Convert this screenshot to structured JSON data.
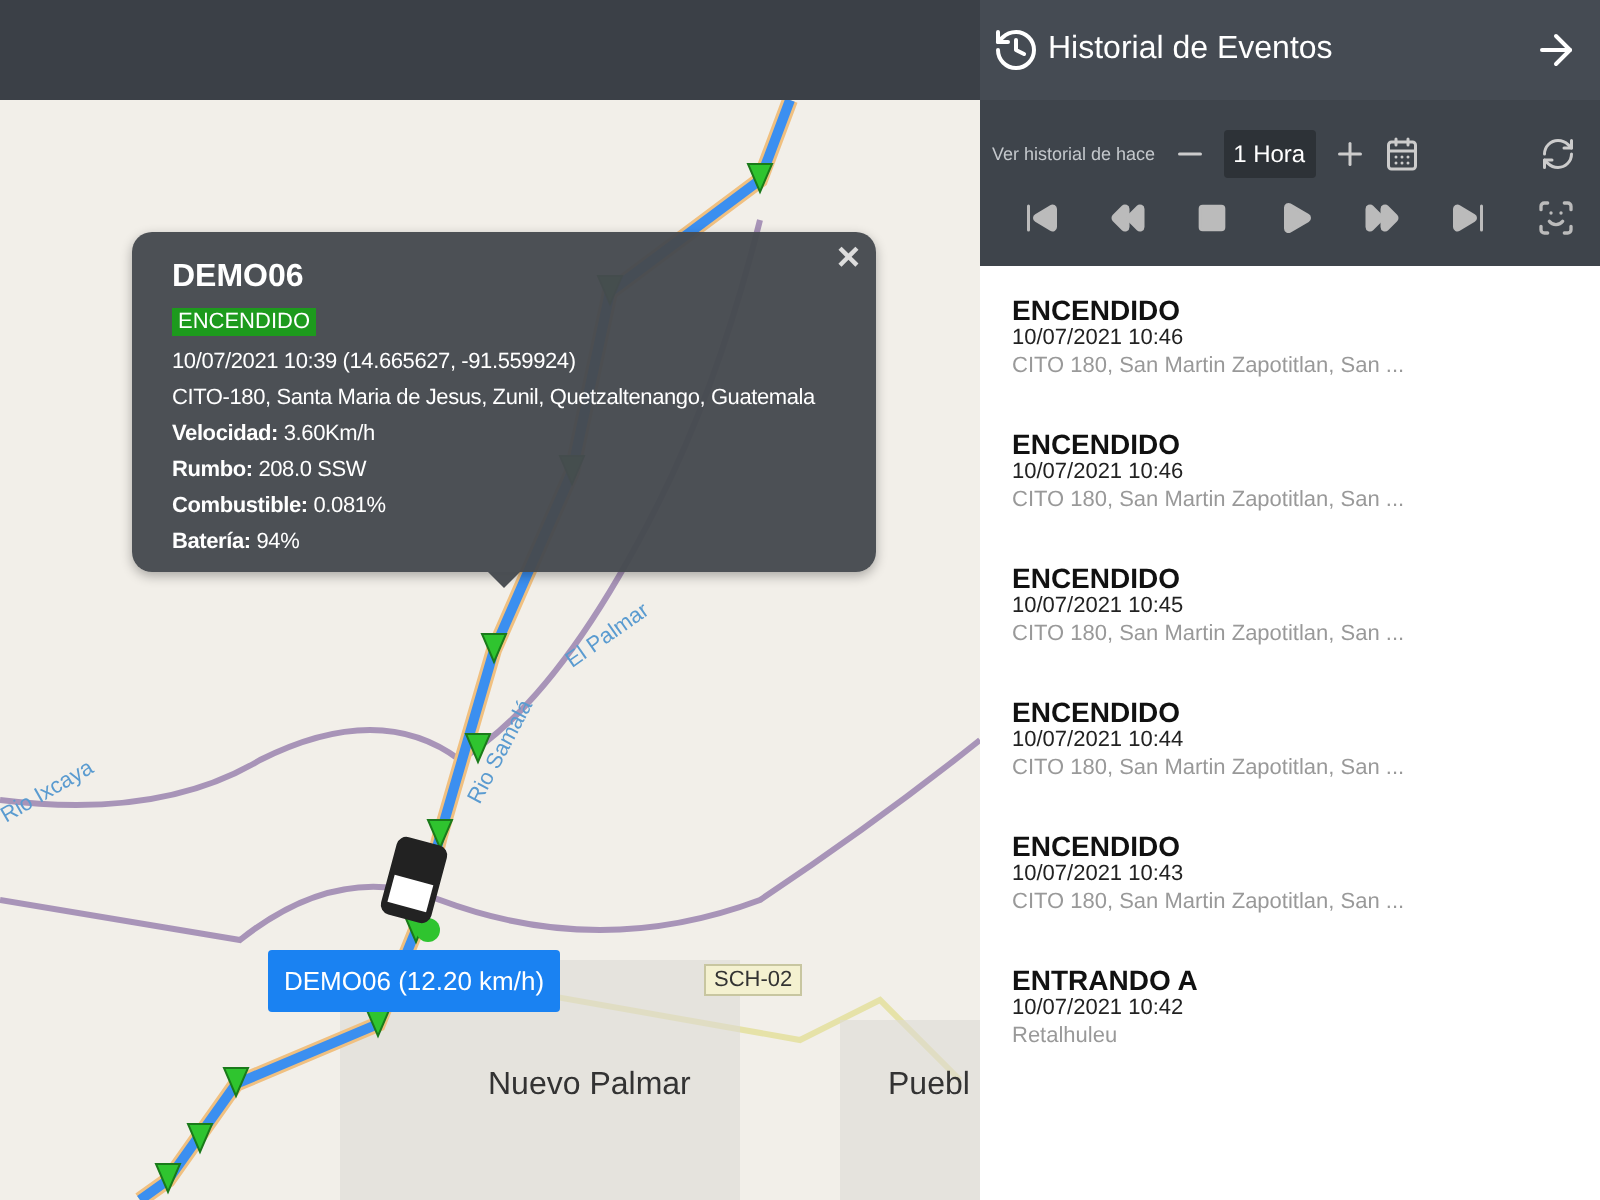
{
  "map": {
    "labels": [
      {
        "text": "El Palmar",
        "kind": "river"
      },
      {
        "text": "Rio Samalá",
        "kind": "river"
      },
      {
        "text": "Rio Ixcaya",
        "kind": "river"
      },
      {
        "text": "SCH-02",
        "kind": "road"
      },
      {
        "text": "Nuevo Palmar",
        "kind": "place"
      },
      {
        "text": "Puebl",
        "kind": "place"
      }
    ],
    "popup": {
      "title": "DEMO06",
      "status": "ENCENDIDO",
      "close": "×",
      "lines": [
        "10/07/2021 10:39 (14.665627, -91.559924)",
        "CITO-180, Santa Maria de Jesus, Zunil, Quetzaltenango, Guatemala",
        "**Velocidad:** 3.60Km/h",
        "**Rumbo:** 208.0 SSW",
        "**Combustible:** 0.081%",
        "**Batería:** 94%"
      ]
    },
    "vehicle_label": "DEMO06 (12.20 km/h)"
  },
  "panel": {
    "title": "Historial de Eventos",
    "range_label": "Ver historial de hace",
    "range_value": "1 Hora",
    "events": [
      {
        "title": "ENCENDIDO",
        "time": "10/07/2021 10:46",
        "place": "CITO 180, San Martin Zapotitlan, San ..."
      },
      {
        "title": "ENCENDIDO",
        "time": "10/07/2021 10:46",
        "place": "CITO 180, San Martin Zapotitlan, San ..."
      },
      {
        "title": "ENCENDIDO",
        "time": "10/07/2021 10:45",
        "place": "CITO 180, San Martin Zapotitlan, San ..."
      },
      {
        "title": "ENCENDIDO",
        "time": "10/07/2021 10:44",
        "place": "CITO 180, San Martin Zapotitlan, San ..."
      },
      {
        "title": "ENCENDIDO",
        "time": "10/07/2021 10:43",
        "place": "CITO 180, San Martin Zapotitlan, San ..."
      },
      {
        "title": "ENTRANDO A",
        "time": "10/07/2021 10:42",
        "place": "Retalhuleu"
      }
    ]
  }
}
